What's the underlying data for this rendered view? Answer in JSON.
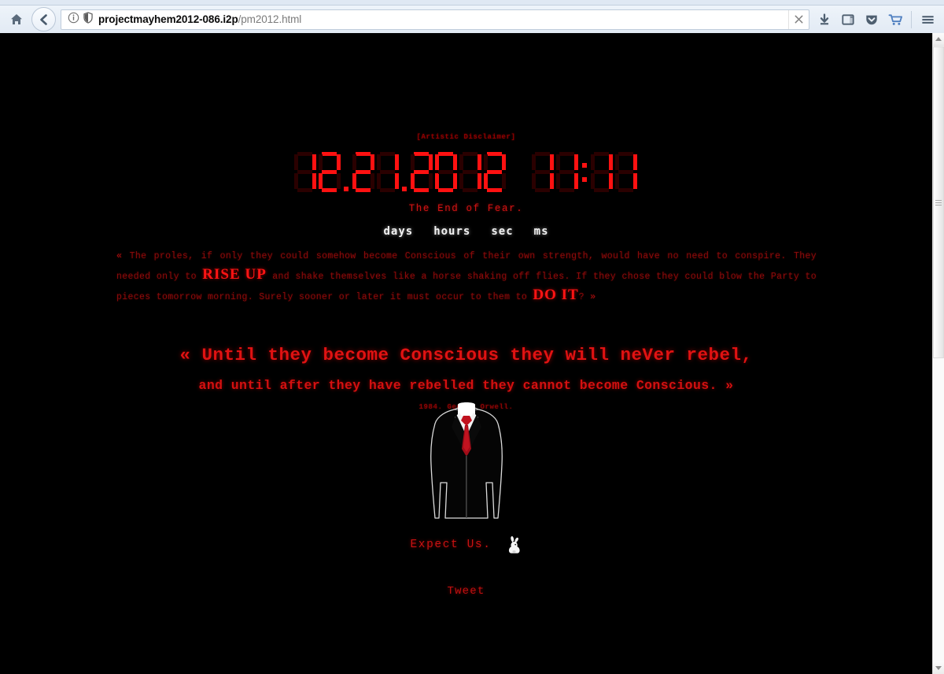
{
  "browser": {
    "home_icon": "home-icon",
    "back_icon": "back-arrow-icon",
    "identity_info_icon": "info-circle-icon",
    "identity_shield_icon": "shield-icon",
    "url_host": "projectmayhem2012-086.i2p",
    "url_path": "/pm2012.html",
    "url_full": "projectmayhem2012-086.i2p/pm2012.html",
    "stop_icon": "close-x-icon",
    "toolbar_right": [
      {
        "name": "downloads-button",
        "icon": "download-arrow-icon"
      },
      {
        "name": "reader-view-button",
        "icon": "window-panel-icon"
      },
      {
        "name": "pocket-button",
        "icon": "pocket-shield-icon"
      },
      {
        "name": "cart-button",
        "icon": "shopping-cart-icon"
      },
      {
        "name": "menu-button",
        "icon": "hamburger-menu-icon"
      }
    ]
  },
  "scrollbar": {
    "up_arrow": "scroll-up-arrow-icon",
    "down_arrow": "scroll-down-arrow-icon",
    "thumb": "scroll-thumb"
  },
  "page": {
    "disclaimer": "[Artistic Disclaimer]",
    "countdown": {
      "date_digits": [
        "1",
        "2",
        ".",
        "2",
        "1",
        ".",
        "2",
        "0",
        "1",
        "2"
      ],
      "time_digits": [
        "1",
        "1",
        ":",
        "1",
        "1"
      ],
      "date_text": "12.21.2012",
      "time_text": "11:11",
      "color": "#ff1111",
      "ghost_color": "#2a0000"
    },
    "tagline": "The End of Fear.",
    "unit_labels": [
      "days",
      "hours",
      "sec",
      "ms"
    ],
    "paragraph": {
      "open_quote": "«",
      "part1": " The proles, if only they could somehow become Conscious of their own strength, would have no need to conspire. They needed only to ",
      "highlight1": "RISE UP",
      "part2": " and shake themselves like a horse shaking off flies. If they chose they could blow the Party to pieces tomorrow morning. Surely sooner or later it must occur to them to ",
      "highlight2": "DO IT",
      "part3": "? ",
      "close_quote": "»"
    },
    "quote_line_1": "« Until they become Conscious they will neVer rebel,",
    "quote_line_2": "and until after they have rebelled they cannot become Conscious. »",
    "attribution": "1984. George Orwell.",
    "figure": {
      "name": "anonymous-suit-figure",
      "suit_color": "#000000",
      "outline_color": "#e8e8e8",
      "shirt_color": "#ffffff",
      "tie_color": "#b00010"
    },
    "expect_us": "Expect Us.",
    "rabbit_icon": "white-rabbit-icon",
    "tweet_label": "Tweet",
    "background_color": "#000000",
    "accent_red": "#ff1111",
    "dim_red": "#8c0b0b"
  }
}
